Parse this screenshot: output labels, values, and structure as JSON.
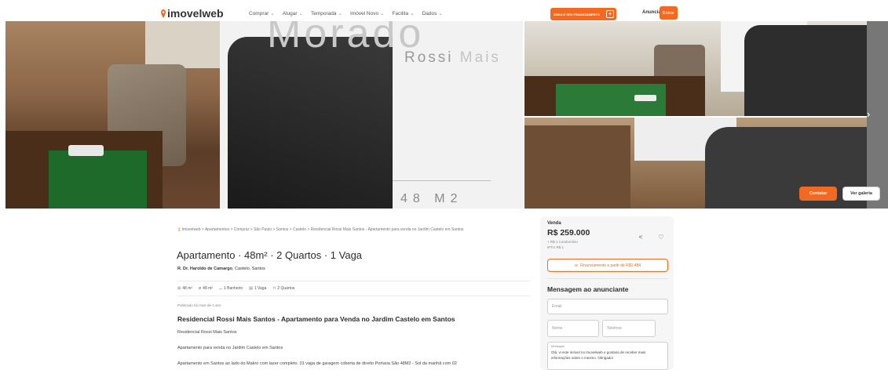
{
  "nav": {
    "logo": "imovelweb",
    "menu": [
      {
        "label": "Comprar"
      },
      {
        "label": "Alugar"
      },
      {
        "label": "Temporada"
      },
      {
        "label": "Imóvel Novo"
      },
      {
        "label": "Facilita"
      },
      {
        "label": "Dados"
      }
    ],
    "finance_button": "SIMULE SEU FINANCIAMENTO",
    "anunciar": "Anunciar",
    "entrar": "Entrar",
    "accent_color": "#f26a22"
  },
  "gallery": {
    "watermark_big": "Morado",
    "watermark_rossi": "Rossi",
    "watermark_mais": "Mais",
    "watermark_area": "48 M2",
    "next_arrow": "›",
    "contatar": "Contatar",
    "ver_galeria": "Ver galeria"
  },
  "breadcrumb": {
    "items": [
      "Imovelweb",
      "Apartamentos",
      "Comprar",
      "São Paulo",
      "Santos",
      "Castelo",
      "Residencial Rossi Mais Santos - Apartamento para venda no Jardim Castelo em Santos"
    ],
    "separator": ">"
  },
  "listing": {
    "title": "Apartamento · 48m² · 2 Quartos · 1 Vaga",
    "address_street": "R. Dr. Haroldo de Camargo",
    "address_area": ", Castelo, Santos",
    "features": [
      {
        "icon": "area-total-icon",
        "label": "48 m²"
      },
      {
        "icon": "area-useful-icon",
        "label": "48 m²"
      },
      {
        "icon": "bath-icon",
        "label": "1 Banheiro"
      },
      {
        "icon": "car-icon",
        "label": "1 Vaga"
      },
      {
        "icon": "bed-icon",
        "label": "2 Quartos"
      }
    ],
    "published": "Publicado há mais de 1 ano",
    "heading": "Residencial Rossi Mais Santos - Apartamento para Venda no Jardim Castelo em Santos",
    "description": [
      "Residencial Rossi Mais Santos",
      "Apartamento para venda no Jardim Castelo em Santos",
      "Apartamento em Santos ao lado do Makro com lazer completo. 01 vaga de garagem coberta de direito Portaria São 48M2 - Sol da manhã com 02"
    ]
  },
  "price_card": {
    "operation": "Venda",
    "price": "R$ 259.000",
    "condominio": "+ R$ 1 Condomínio",
    "iptu": "IPTU R$ 1",
    "financing": "Financiamento a partir de R$1.484",
    "message_title": "Mensagem ao anunciante",
    "email_placeholder": "Email",
    "nome_placeholder": "Nome",
    "telefone_placeholder": "Telefone",
    "message_label": "Mensagem",
    "message_text": "Olá, vi este imóvel no Imovelweb e gostaria de receber mais informações sobre o mesmo. Obrigado!"
  }
}
